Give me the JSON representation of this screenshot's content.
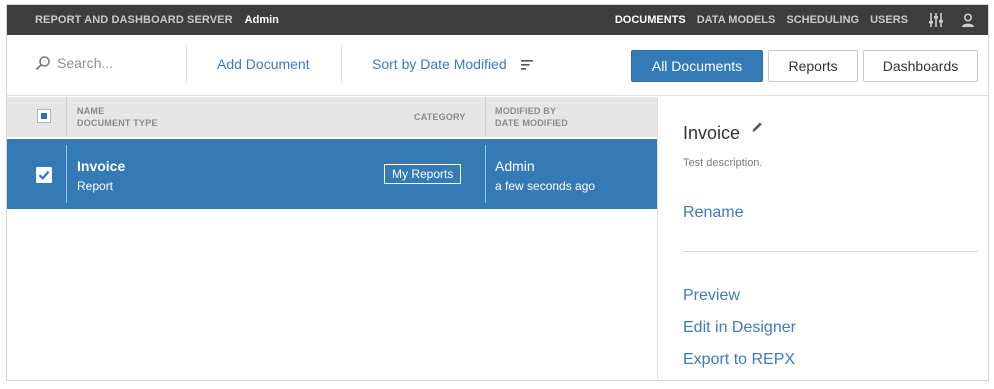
{
  "header": {
    "brand": "REPORT AND DASHBOARD SERVER",
    "user": "Admin",
    "nav": [
      {
        "label": "DOCUMENTS",
        "active": true
      },
      {
        "label": "DATA MODELS",
        "active": false
      },
      {
        "label": "SCHEDULING",
        "active": false
      },
      {
        "label": "USERS",
        "active": false
      }
    ],
    "icons": [
      "settings-sliders-icon",
      "user-profile-icon"
    ]
  },
  "toolbar": {
    "search_placeholder": "Search...",
    "add_document": "Add Document",
    "sort_label": "Sort by Date Modified",
    "filters": [
      {
        "label": "All Documents",
        "active": true
      },
      {
        "label": "Reports",
        "active": false
      },
      {
        "label": "Dashboards",
        "active": false
      }
    ]
  },
  "list": {
    "columns": {
      "name": "NAME",
      "type": "DOCUMENT TYPE",
      "category": "CATEGORY",
      "modified_by": "MODIFIED BY",
      "date_modified": "DATE MODIFIED"
    },
    "rows": [
      {
        "name": "Invoice",
        "type": "Report",
        "category": "My Reports",
        "modified_by": "Admin",
        "date": "a few seconds ago",
        "selected": true
      }
    ]
  },
  "details": {
    "title": "Invoice",
    "description": "Test description.",
    "rename": "Rename",
    "actions": [
      "Preview",
      "Edit in Designer",
      "Export to REPX"
    ]
  },
  "colors": {
    "accent": "#337ab7",
    "topbar": "#3d3d3d",
    "link": "#3a7bc0"
  }
}
